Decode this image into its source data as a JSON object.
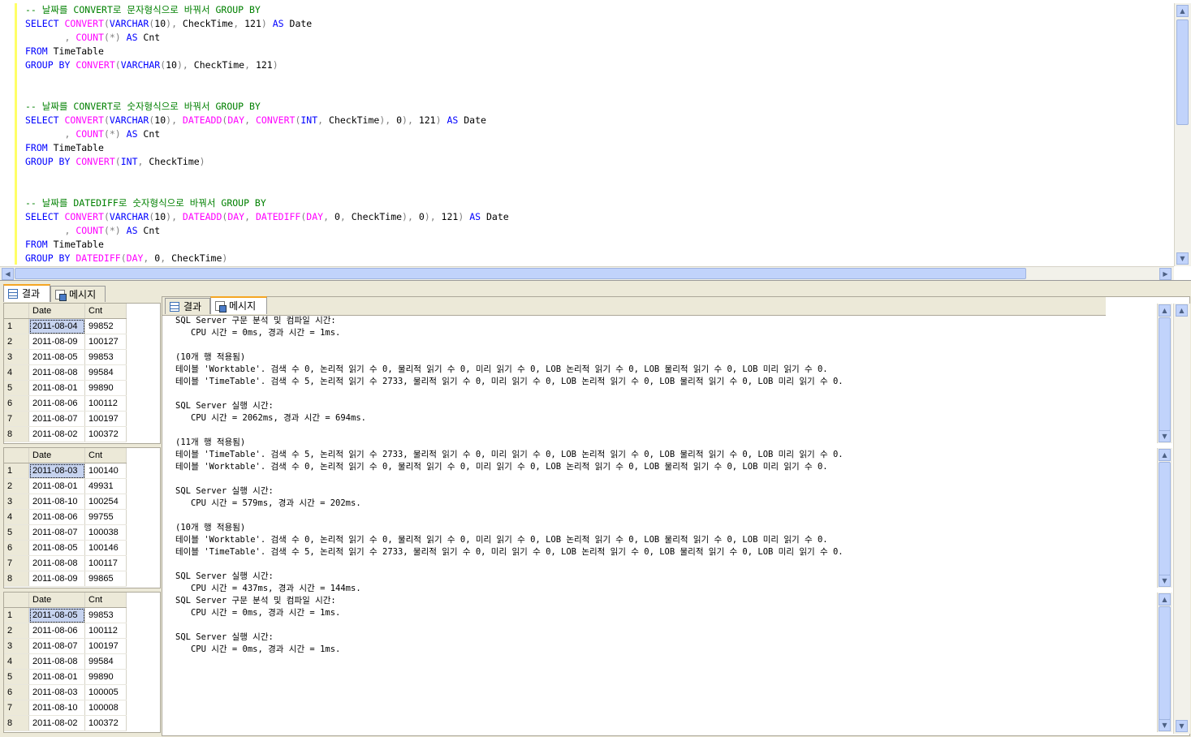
{
  "editor": {
    "lines": [
      [
        {
          "t": "-- 날짜를 CONVERT로 문자형식으로 바꿔서 GROUP BY",
          "c": "t-comment"
        }
      ],
      [
        {
          "t": "SELECT ",
          "c": "t-kw"
        },
        {
          "t": "CONVERT",
          "c": "t-fn"
        },
        {
          "t": "(",
          "c": "t-op"
        },
        {
          "t": "VARCHAR",
          "c": "t-kw"
        },
        {
          "t": "(",
          "c": "t-op"
        },
        {
          "t": "10",
          "c": ""
        },
        {
          "t": "), ",
          "c": "t-op"
        },
        {
          "t": "CheckTime",
          "c": ""
        },
        {
          "t": ", ",
          "c": "t-op"
        },
        {
          "t": "121",
          "c": ""
        },
        {
          "t": ") ",
          "c": "t-op"
        },
        {
          "t": "AS ",
          "c": "t-kw"
        },
        {
          "t": "Date",
          "c": ""
        }
      ],
      [
        {
          "t": "       , ",
          "c": "t-op"
        },
        {
          "t": "COUNT",
          "c": "t-fn"
        },
        {
          "t": "(*) ",
          "c": "t-op"
        },
        {
          "t": "AS ",
          "c": "t-kw"
        },
        {
          "t": "Cnt",
          "c": ""
        }
      ],
      [
        {
          "t": "FROM ",
          "c": "t-kw"
        },
        {
          "t": "TimeTable",
          "c": ""
        }
      ],
      [
        {
          "t": "GROUP BY ",
          "c": "t-kw"
        },
        {
          "t": "CONVERT",
          "c": "t-fn"
        },
        {
          "t": "(",
          "c": "t-op"
        },
        {
          "t": "VARCHAR",
          "c": "t-kw"
        },
        {
          "t": "(",
          "c": "t-op"
        },
        {
          "t": "10",
          "c": ""
        },
        {
          "t": "), ",
          "c": "t-op"
        },
        {
          "t": "CheckTime",
          "c": ""
        },
        {
          "t": ", ",
          "c": "t-op"
        },
        {
          "t": "121",
          "c": ""
        },
        {
          "t": ")",
          "c": "t-op"
        }
      ],
      [],
      [],
      [
        {
          "t": "-- 날짜를 CONVERT로 숫자형식으로 바꿔서 GROUP BY",
          "c": "t-comment"
        }
      ],
      [
        {
          "t": "SELECT ",
          "c": "t-kw"
        },
        {
          "t": "CONVERT",
          "c": "t-fn"
        },
        {
          "t": "(",
          "c": "t-op"
        },
        {
          "t": "VARCHAR",
          "c": "t-kw"
        },
        {
          "t": "(",
          "c": "t-op"
        },
        {
          "t": "10",
          "c": ""
        },
        {
          "t": "), ",
          "c": "t-op"
        },
        {
          "t": "DATEADD",
          "c": "t-fn"
        },
        {
          "t": "(",
          "c": "t-op"
        },
        {
          "t": "DAY",
          "c": "t-fn"
        },
        {
          "t": ", ",
          "c": "t-op"
        },
        {
          "t": "CONVERT",
          "c": "t-fn"
        },
        {
          "t": "(",
          "c": "t-op"
        },
        {
          "t": "INT",
          "c": "t-kw"
        },
        {
          "t": ", ",
          "c": "t-op"
        },
        {
          "t": "CheckTime",
          "c": ""
        },
        {
          "t": "), ",
          "c": "t-op"
        },
        {
          "t": "0",
          "c": ""
        },
        {
          "t": "), ",
          "c": "t-op"
        },
        {
          "t": "121",
          "c": ""
        },
        {
          "t": ") ",
          "c": "t-op"
        },
        {
          "t": "AS ",
          "c": "t-kw"
        },
        {
          "t": "Date",
          "c": ""
        }
      ],
      [
        {
          "t": "       , ",
          "c": "t-op"
        },
        {
          "t": "COUNT",
          "c": "t-fn"
        },
        {
          "t": "(*) ",
          "c": "t-op"
        },
        {
          "t": "AS ",
          "c": "t-kw"
        },
        {
          "t": "Cnt",
          "c": ""
        }
      ],
      [
        {
          "t": "FROM ",
          "c": "t-kw"
        },
        {
          "t": "TimeTable",
          "c": ""
        }
      ],
      [
        {
          "t": "GROUP BY ",
          "c": "t-kw"
        },
        {
          "t": "CONVERT",
          "c": "t-fn"
        },
        {
          "t": "(",
          "c": "t-op"
        },
        {
          "t": "INT",
          "c": "t-kw"
        },
        {
          "t": ", ",
          "c": "t-op"
        },
        {
          "t": "CheckTime",
          "c": ""
        },
        {
          "t": ")",
          "c": "t-op"
        }
      ],
      [],
      [],
      [
        {
          "t": "-- 날짜를 DATEDIFF로 숫자형식으로 바꿔서 GROUP BY",
          "c": "t-comment"
        }
      ],
      [
        {
          "t": "SELECT ",
          "c": "t-kw"
        },
        {
          "t": "CONVERT",
          "c": "t-fn"
        },
        {
          "t": "(",
          "c": "t-op"
        },
        {
          "t": "VARCHAR",
          "c": "t-kw"
        },
        {
          "t": "(",
          "c": "t-op"
        },
        {
          "t": "10",
          "c": ""
        },
        {
          "t": "), ",
          "c": "t-op"
        },
        {
          "t": "DATEADD",
          "c": "t-fn"
        },
        {
          "t": "(",
          "c": "t-op"
        },
        {
          "t": "DAY",
          "c": "t-fn"
        },
        {
          "t": ", ",
          "c": "t-op"
        },
        {
          "t": "DATEDIFF",
          "c": "t-fn"
        },
        {
          "t": "(",
          "c": "t-op"
        },
        {
          "t": "DAY",
          "c": "t-fn"
        },
        {
          "t": ", ",
          "c": "t-op"
        },
        {
          "t": "0",
          "c": ""
        },
        {
          "t": ", ",
          "c": "t-op"
        },
        {
          "t": "CheckTime",
          "c": ""
        },
        {
          "t": "), ",
          "c": "t-op"
        },
        {
          "t": "0",
          "c": ""
        },
        {
          "t": "), ",
          "c": "t-op"
        },
        {
          "t": "121",
          "c": ""
        },
        {
          "t": ") ",
          "c": "t-op"
        },
        {
          "t": "AS ",
          "c": "t-kw"
        },
        {
          "t": "Date",
          "c": ""
        }
      ],
      [
        {
          "t": "       , ",
          "c": "t-op"
        },
        {
          "t": "COUNT",
          "c": "t-fn"
        },
        {
          "t": "(*) ",
          "c": "t-op"
        },
        {
          "t": "AS ",
          "c": "t-kw"
        },
        {
          "t": "Cnt",
          "c": ""
        }
      ],
      [
        {
          "t": "FROM ",
          "c": "t-kw"
        },
        {
          "t": "TimeTable",
          "c": ""
        }
      ],
      [
        {
          "t": "GROUP BY ",
          "c": "t-kw"
        },
        {
          "t": "DATEDIFF",
          "c": "t-fn"
        },
        {
          "t": "(",
          "c": "t-op"
        },
        {
          "t": "DAY",
          "c": "t-fn"
        },
        {
          "t": ", ",
          "c": "t-op"
        },
        {
          "t": "0",
          "c": ""
        },
        {
          "t": ", ",
          "c": "t-op"
        },
        {
          "t": "CheckTime",
          "c": ""
        },
        {
          "t": ")",
          "c": "t-op"
        }
      ]
    ]
  },
  "outer_tabs": {
    "results": "결과",
    "messages": "메시지"
  },
  "inner_tabs": {
    "results": "결과",
    "messages": "메시지"
  },
  "scroll_arrows": {
    "up": "▲",
    "down": "▼",
    "left": "◀",
    "right": "▶"
  },
  "grids": [
    {
      "headers": [
        "Date",
        "Cnt"
      ],
      "rows": [
        [
          "1",
          "2011-08-04",
          "99852"
        ],
        [
          "2",
          "2011-08-09",
          "100127"
        ],
        [
          "3",
          "2011-08-05",
          "99853"
        ],
        [
          "4",
          "2011-08-08",
          "99584"
        ],
        [
          "5",
          "2011-08-01",
          "99890"
        ],
        [
          "6",
          "2011-08-06",
          "100112"
        ],
        [
          "7",
          "2011-08-07",
          "100197"
        ],
        [
          "8",
          "2011-08-02",
          "100372"
        ]
      ]
    },
    {
      "headers": [
        "Date",
        "Cnt"
      ],
      "rows": [
        [
          "1",
          "2011-08-03",
          "100140"
        ],
        [
          "2",
          "2011-08-01",
          "49931"
        ],
        [
          "3",
          "2011-08-10",
          "100254"
        ],
        [
          "4",
          "2011-08-06",
          "99755"
        ],
        [
          "5",
          "2011-08-07",
          "100038"
        ],
        [
          "6",
          "2011-08-05",
          "100146"
        ],
        [
          "7",
          "2011-08-08",
          "100117"
        ],
        [
          "8",
          "2011-08-09",
          "99865"
        ]
      ]
    },
    {
      "headers": [
        "Date",
        "Cnt"
      ],
      "rows": [
        [
          "1",
          "2011-08-05",
          "99853"
        ],
        [
          "2",
          "2011-08-06",
          "100112"
        ],
        [
          "3",
          "2011-08-07",
          "100197"
        ],
        [
          "4",
          "2011-08-08",
          "99584"
        ],
        [
          "5",
          "2011-08-01",
          "99890"
        ],
        [
          "6",
          "2011-08-03",
          "100005"
        ],
        [
          "7",
          "2011-08-10",
          "100008"
        ],
        [
          "8",
          "2011-08-02",
          "100372"
        ]
      ]
    }
  ],
  "messages": [
    "SQL Server 구문 분석 및 컴파일 시간:",
    "   CPU 시간 = 0ms, 경과 시간 = 1ms.",
    "",
    "(10개 행 적용됨)",
    "테이블 'Worktable'. 검색 수 0, 논리적 읽기 수 0, 물리적 읽기 수 0, 미리 읽기 수 0, LOB 논리적 읽기 수 0, LOB 물리적 읽기 수 0, LOB 미리 읽기 수 0.",
    "테이블 'TimeTable'. 검색 수 5, 논리적 읽기 수 2733, 물리적 읽기 수 0, 미리 읽기 수 0, LOB 논리적 읽기 수 0, LOB 물리적 읽기 수 0, LOB 미리 읽기 수 0.",
    "",
    "SQL Server 실행 시간:",
    "   CPU 시간 = 2062ms, 경과 시간 = 694ms.",
    "",
    "(11개 행 적용됨)",
    "테이블 'TimeTable'. 검색 수 5, 논리적 읽기 수 2733, 물리적 읽기 수 0, 미리 읽기 수 0, LOB 논리적 읽기 수 0, LOB 물리적 읽기 수 0, LOB 미리 읽기 수 0.",
    "테이블 'Worktable'. 검색 수 0, 논리적 읽기 수 0, 물리적 읽기 수 0, 미리 읽기 수 0, LOB 논리적 읽기 수 0, LOB 물리적 읽기 수 0, LOB 미리 읽기 수 0.",
    "",
    "SQL Server 실행 시간:",
    "   CPU 시간 = 579ms, 경과 시간 = 202ms.",
    "",
    "(10개 행 적용됨)",
    "테이블 'Worktable'. 검색 수 0, 논리적 읽기 수 0, 물리적 읽기 수 0, 미리 읽기 수 0, LOB 논리적 읽기 수 0, LOB 물리적 읽기 수 0, LOB 미리 읽기 수 0.",
    "테이블 'TimeTable'. 검색 수 5, 논리적 읽기 수 2733, 물리적 읽기 수 0, 미리 읽기 수 0, LOB 논리적 읽기 수 0, LOB 물리적 읽기 수 0, LOB 미리 읽기 수 0.",
    "",
    "SQL Server 실행 시간:",
    "   CPU 시간 = 437ms, 경과 시간 = 144ms.",
    "SQL Server 구문 분석 및 컴파일 시간:",
    "   CPU 시간 = 0ms, 경과 시간 = 1ms.",
    "",
    "SQL Server 실행 시간:",
    "   CPU 시간 = 0ms, 경과 시간 = 1ms."
  ]
}
